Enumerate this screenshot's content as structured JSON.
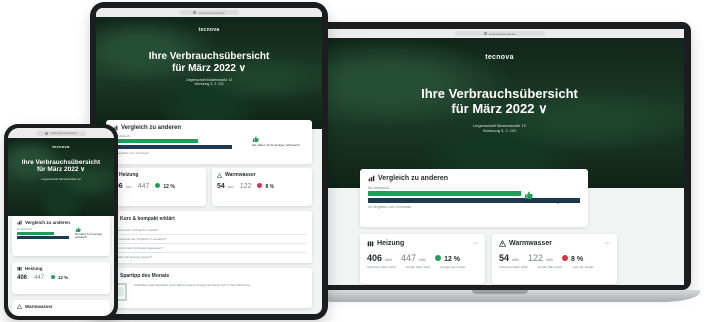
{
  "brand": "tecnova",
  "url": "verbrauchsportal.de",
  "hero": {
    "title_line1": "Ihre Verbrauchsübersicht",
    "title_line2": "für März 2022 ∨",
    "sub_line1": "Liegenschaft Musterstraße 12",
    "sub_line2": "Wohnung 3, 2. OG"
  },
  "comparison": {
    "title": "Vergleich zu anderen",
    "label_you": "Ihr Verbrauch",
    "label_others": "Durchschnitt",
    "note": "im Vergleich zum Vormonat",
    "feedback": "Sie haben 12 % weniger verbraucht",
    "you_fraction": 0.72,
    "others_fraction": 1.0
  },
  "heating": {
    "title": "Heizung",
    "value": "406",
    "unit": "kWh",
    "compare_value": "447",
    "compare_unit": "kWh",
    "change": "12 %",
    "label_current": "Verbrauch März 2022",
    "label_compare": "Vorjahr März 2021",
    "label_change": "weniger als Vorjahr"
  },
  "warmwater": {
    "title": "Warmwasser",
    "value": "54",
    "unit": "kWh",
    "compare_value": "122",
    "compare_unit": "kWh",
    "change": "8 %",
    "label_current": "Verbrauch März 2022",
    "label_compare": "Vorjahr März 2021",
    "label_change": "mehr als Vorjahr"
  },
  "faq": {
    "title": "Kurz & kompakt erklärt",
    "items": [
      "Wie wird mein Verbrauch ermittelt?",
      "Was bedeutet der Vergleich zu anderen?",
      "Warum ist mein Verbrauch gestiegen?",
      "Wie kann ich Energie sparen?"
    ]
  },
  "tip": {
    "title": "Spartipp des Monats",
    "text": "Stoßlüften statt Kipplüften spart Heizenergie und sorgt für frische Luft in Ihrer Wohnung."
  },
  "colors": {
    "green": "#1f9e5a",
    "navy": "#1e3a52",
    "red": "#d6304a",
    "forest": "#1c3a27"
  }
}
